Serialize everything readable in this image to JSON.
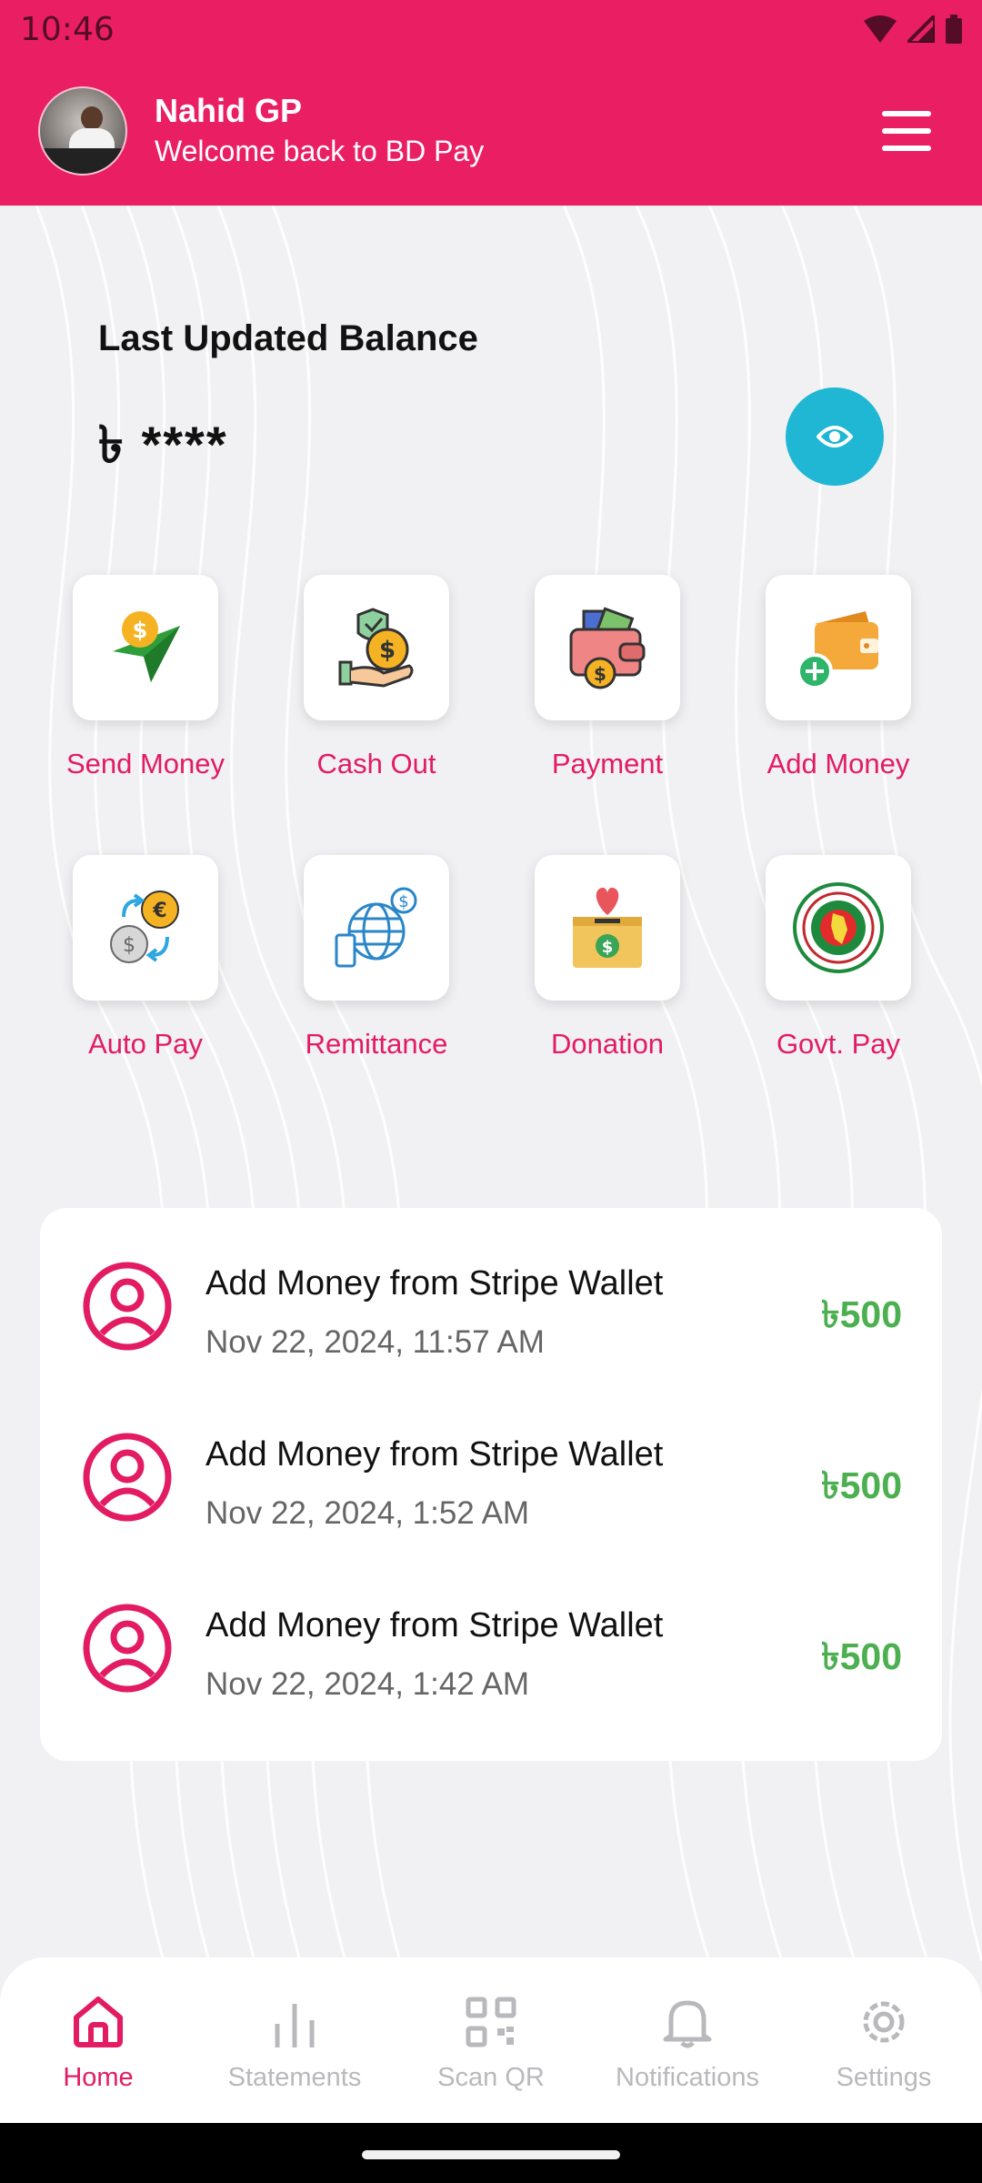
{
  "status_bar": {
    "time": "10:46"
  },
  "header": {
    "user_name": "Nahid GP",
    "welcome": "Welcome back to BD Pay"
  },
  "balance": {
    "title": "Last Updated Balance",
    "value": "৳ ****"
  },
  "services": [
    {
      "label": "Send Money",
      "icon": "send-money-icon"
    },
    {
      "label": "Cash Out",
      "icon": "cash-out-icon"
    },
    {
      "label": "Payment",
      "icon": "payment-wallet-icon"
    },
    {
      "label": "Add Money",
      "icon": "add-money-wallet-icon"
    },
    {
      "label": "Auto Pay",
      "icon": "auto-pay-currency-icon"
    },
    {
      "label": "Remittance",
      "icon": "remittance-globe-icon"
    },
    {
      "label": "Donation",
      "icon": "donation-box-icon"
    },
    {
      "label": "Govt. Pay",
      "icon": "govt-seal-icon"
    }
  ],
  "transactions": [
    {
      "title": "Add Money from Stripe Wallet",
      "date": "Nov 22, 2024, 11:57 AM",
      "amount": "৳500"
    },
    {
      "title": "Add Money from Stripe Wallet",
      "date": "Nov 22, 2024, 1:52 AM",
      "amount": "৳500"
    },
    {
      "title": "Add Money from Stripe Wallet",
      "date": "Nov 22, 2024, 1:42 AM",
      "amount": "৳500"
    }
  ],
  "bottom_nav": [
    {
      "label": "Home",
      "icon": "home-icon",
      "active": true
    },
    {
      "label": "Statements",
      "icon": "bar-chart-icon",
      "active": false
    },
    {
      "label": "Scan QR",
      "icon": "qr-code-icon",
      "active": false
    },
    {
      "label": "Notifications",
      "icon": "bell-icon",
      "active": false
    },
    {
      "label": "Settings",
      "icon": "gear-icon",
      "active": false
    }
  ],
  "colors": {
    "brand": "#ea1f63",
    "accent_label": "#e21b63",
    "amount": "#4caf50",
    "eye_button": "#1fb7d3"
  }
}
